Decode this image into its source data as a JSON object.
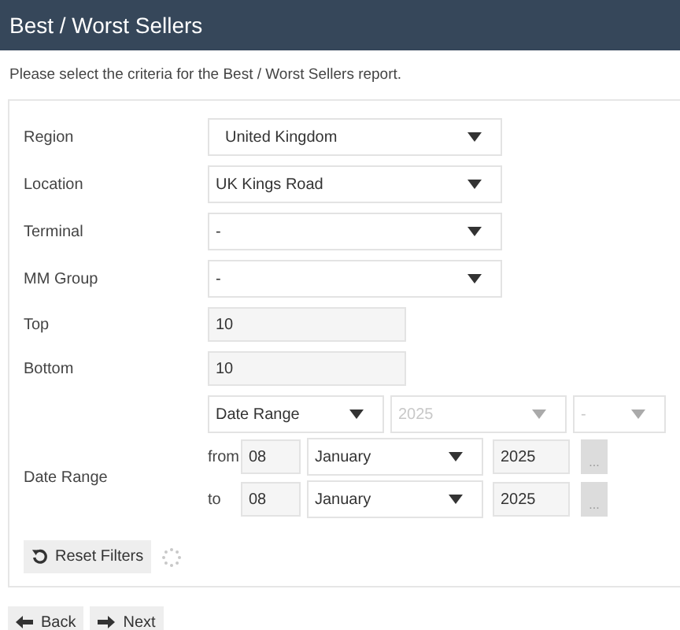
{
  "header": {
    "title": "Best / Worst Sellers"
  },
  "intro": "Please select the criteria for the Best / Worst Sellers report.",
  "fields": [
    {
      "label": "Region",
      "kind": "select",
      "value": "United Kingdom",
      "indent": true
    },
    {
      "label": "Location",
      "kind": "select",
      "value": "UK Kings Road",
      "indent": false
    },
    {
      "label": "Terminal",
      "kind": "select",
      "value": "-",
      "indent": false
    },
    {
      "label": "MM Group",
      "kind": "select",
      "value": "-",
      "indent": false
    },
    {
      "label": "Top",
      "kind": "input",
      "value": "10"
    },
    {
      "label": "Bottom",
      "kind": "input",
      "value": "10"
    }
  ],
  "date_range": {
    "label": "Date Range",
    "selectors": [
      {
        "value": "Date Range",
        "disabled": false
      },
      {
        "value": "2025",
        "disabled": true
      },
      {
        "value": "-",
        "disabled": true
      }
    ],
    "rows": [
      {
        "prefix": "from",
        "day": "08",
        "month": "January",
        "year": "2025",
        "button": "..."
      },
      {
        "prefix": "to",
        "day": "08",
        "month": "January",
        "year": "2025",
        "button": "..."
      }
    ]
  },
  "reset_button": "Reset Filters",
  "nav_buttons": [
    {
      "label": "Back",
      "kind": "back"
    },
    {
      "label": "Next",
      "kind": "next"
    }
  ]
}
